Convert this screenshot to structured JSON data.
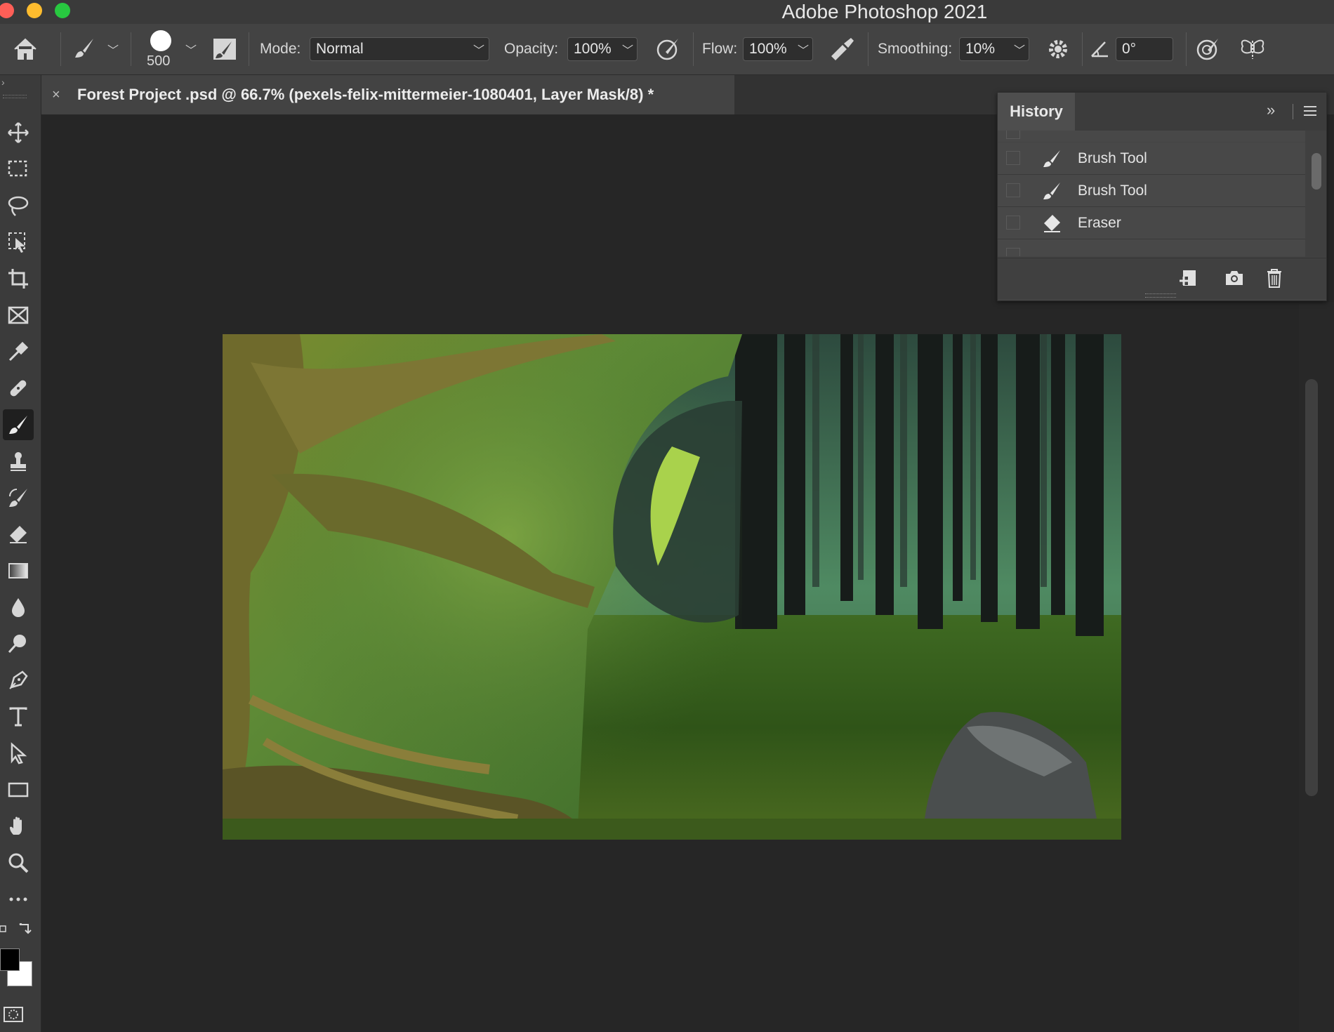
{
  "app": {
    "title": "Adobe Photoshop 2021"
  },
  "options": {
    "brush_size": "500",
    "mode_label": "Mode:",
    "mode_value": "Normal",
    "opacity_label": "Opacity:",
    "opacity_value": "100%",
    "flow_label": "Flow:",
    "flow_value": "100%",
    "smoothing_label": "Smoothing:",
    "smoothing_value": "10%",
    "angle_value": "0°"
  },
  "document": {
    "tab_label": "Forest Project .psd @ 66.7% (pexels-felix-mittermeier-1080401, Layer Mask/8) *",
    "close_glyph": "×"
  },
  "history": {
    "tab": "History",
    "items": [
      {
        "label": "Brush Tool",
        "icon": "brush-icon"
      },
      {
        "label": "Brush Tool",
        "icon": "brush-icon"
      },
      {
        "label": "Eraser",
        "icon": "eraser-icon"
      }
    ]
  },
  "colors": {
    "foreground": "#000000",
    "background": "#ffffff",
    "accent": "#2d8ceb"
  }
}
